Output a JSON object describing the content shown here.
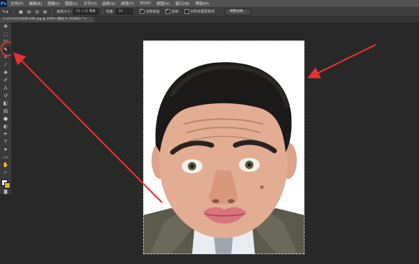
{
  "app": {
    "logo": "Ps",
    "menus": [
      "文件(F)",
      "编辑(E)",
      "图像(I)",
      "图层(L)",
      "文字(Y)",
      "选择(S)",
      "滤镜(T)",
      "3D(D)",
      "视图(V)",
      "窗口(W)",
      "帮助(H)"
    ]
  },
  "options": {
    "brush_size_label": "画笔大小:",
    "brush_size_value": "11 x 11 像素",
    "tolerance_label": "容差:",
    "tolerance_value": "10",
    "antialias_label": "消除锯齿",
    "contiguous_label": "连续",
    "sample_all_label": "对所有图层取样",
    "refine_edge_button": "调整边缘..."
  },
  "document": {
    "tab_title": "1-111121Z16Q0-281.jpg @ 100% (图层 0, RGB/8) * ×"
  },
  "toolbox": {
    "tools": [
      "move-icon",
      "marquee-icon",
      "lasso-icon",
      "quick-selection-icon",
      "crop-icon",
      "eyedropper-icon",
      "healing-brush-icon",
      "brush-icon",
      "clone-stamp-icon",
      "history-brush-icon",
      "eraser-icon",
      "gradient-icon",
      "blur-icon",
      "dodge-icon",
      "pen-icon",
      "type-icon",
      "path-selection-icon",
      "shape-icon",
      "hand-icon",
      "zoom-icon"
    ],
    "active_tool": "quick-selection-icon"
  },
  "colors": {
    "annotation": "#e83030",
    "foreground": "#ffffff",
    "background": "#d4b640"
  }
}
